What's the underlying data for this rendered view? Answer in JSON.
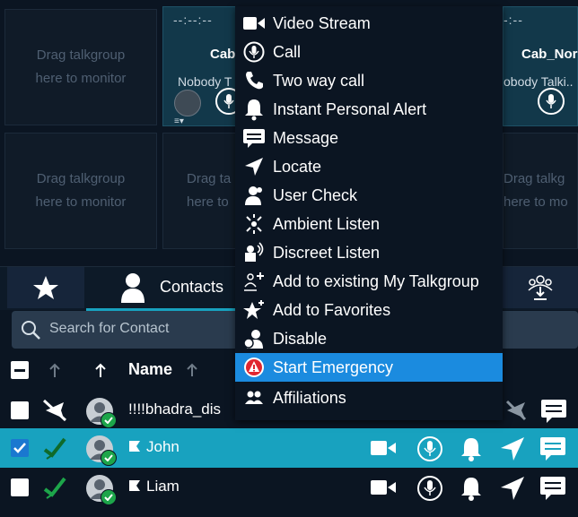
{
  "monitor": {
    "drag_text": "Drag talkgroup\nhere to monitor",
    "drag_text_partial": "Drag ta\nhere to",
    "drag_text_right": "Drag talkg\nhere to mo",
    "tile_left": {
      "time": "--:--:--",
      "name": "Cab",
      "status": "Nobody T"
    },
    "tile_right": {
      "time": "-:--",
      "name": "Cab_Nor",
      "status": "obody Talki.."
    }
  },
  "tabs": {
    "contacts_label": "Contacts"
  },
  "search": {
    "placeholder": "Search for Contact"
  },
  "list": {
    "name_header": "Name",
    "rows": [
      {
        "name": "!!!!bhadra_dis",
        "checked": false,
        "selected": false
      },
      {
        "name": "John",
        "checked": true,
        "selected": true
      },
      {
        "name": "Liam",
        "checked": false,
        "selected": false
      }
    ]
  },
  "menu": {
    "items": [
      {
        "label": "Video Stream",
        "icon": "video-icon"
      },
      {
        "label": "Call",
        "icon": "microphone-icon"
      },
      {
        "label": "Two way call",
        "icon": "phone-icon"
      },
      {
        "label": "Instant Personal Alert",
        "icon": "bell-icon"
      },
      {
        "label": "Message",
        "icon": "message-icon"
      },
      {
        "label": "Locate",
        "icon": "locate-arrow-icon"
      },
      {
        "label": "User Check",
        "icon": "user-check-icon"
      },
      {
        "label": "Ambient Listen",
        "icon": "ambient-listen-icon"
      },
      {
        "label": "Discreet Listen",
        "icon": "discreet-listen-icon"
      },
      {
        "label": "Add to existing My Talkgroup",
        "icon": "add-talkgroup-icon"
      },
      {
        "label": "Add to Favorites",
        "icon": "star-plus-icon"
      },
      {
        "label": "Disable",
        "icon": "disable-user-icon"
      },
      {
        "label": "Start Emergency",
        "icon": "emergency-icon",
        "highlighted": true
      },
      {
        "label": "Affiliations",
        "icon": "affiliations-icon"
      }
    ]
  },
  "colors": {
    "accent": "#18a2bf",
    "menu_highlight": "#1b8bdf",
    "online_green": "#1da54a",
    "emergency_red": "#e0262f"
  }
}
